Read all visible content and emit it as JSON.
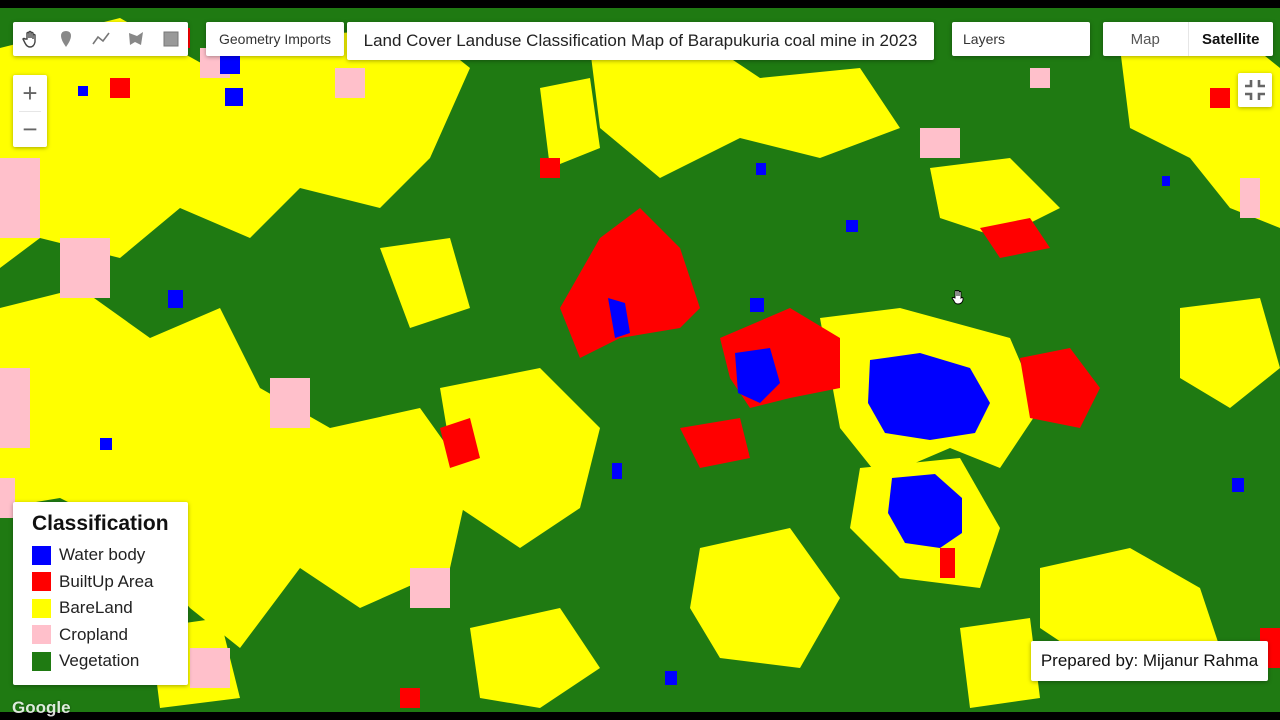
{
  "toolbar": {
    "tools": [
      {
        "name": "hand-tool",
        "icon": "hand-icon"
      },
      {
        "name": "marker-tool",
        "icon": "marker-icon"
      },
      {
        "name": "line-tool",
        "icon": "line-icon"
      },
      {
        "name": "polygon-tool",
        "icon": "polygon-icon"
      },
      {
        "name": "rectangle-tool",
        "icon": "rectangle-icon"
      }
    ],
    "geometry_imports": "Geometry Imports"
  },
  "map_title": "Land Cover Landuse Classification Map of Barapukuria coal mine in 2023",
  "layers_label": "Layers",
  "map_type": {
    "options": [
      "Map",
      "Satellite"
    ],
    "selected": "Satellite"
  },
  "zoom": {
    "in_label": "+",
    "out_label": "−"
  },
  "legend": {
    "title": "Classification",
    "items": [
      {
        "label": "Water body",
        "color": "#0000ff"
      },
      {
        "label": "BuiltUp Area",
        "color": "#ff0000"
      },
      {
        "label": "BareLand",
        "color": "#ffff00"
      },
      {
        "label": "Cropland",
        "color": "#ffc0cb"
      },
      {
        "label": "Vegetation",
        "color": "#1f7a12"
      }
    ]
  },
  "credit": "Prepared by: Mijanur Rahma",
  "attribution": "Google",
  "colors": {
    "water": "#0000ff",
    "builtup": "#ff0000",
    "bareland": "#ffff00",
    "cropland": "#ffc0cb",
    "vegetation": "#1f7a12"
  }
}
